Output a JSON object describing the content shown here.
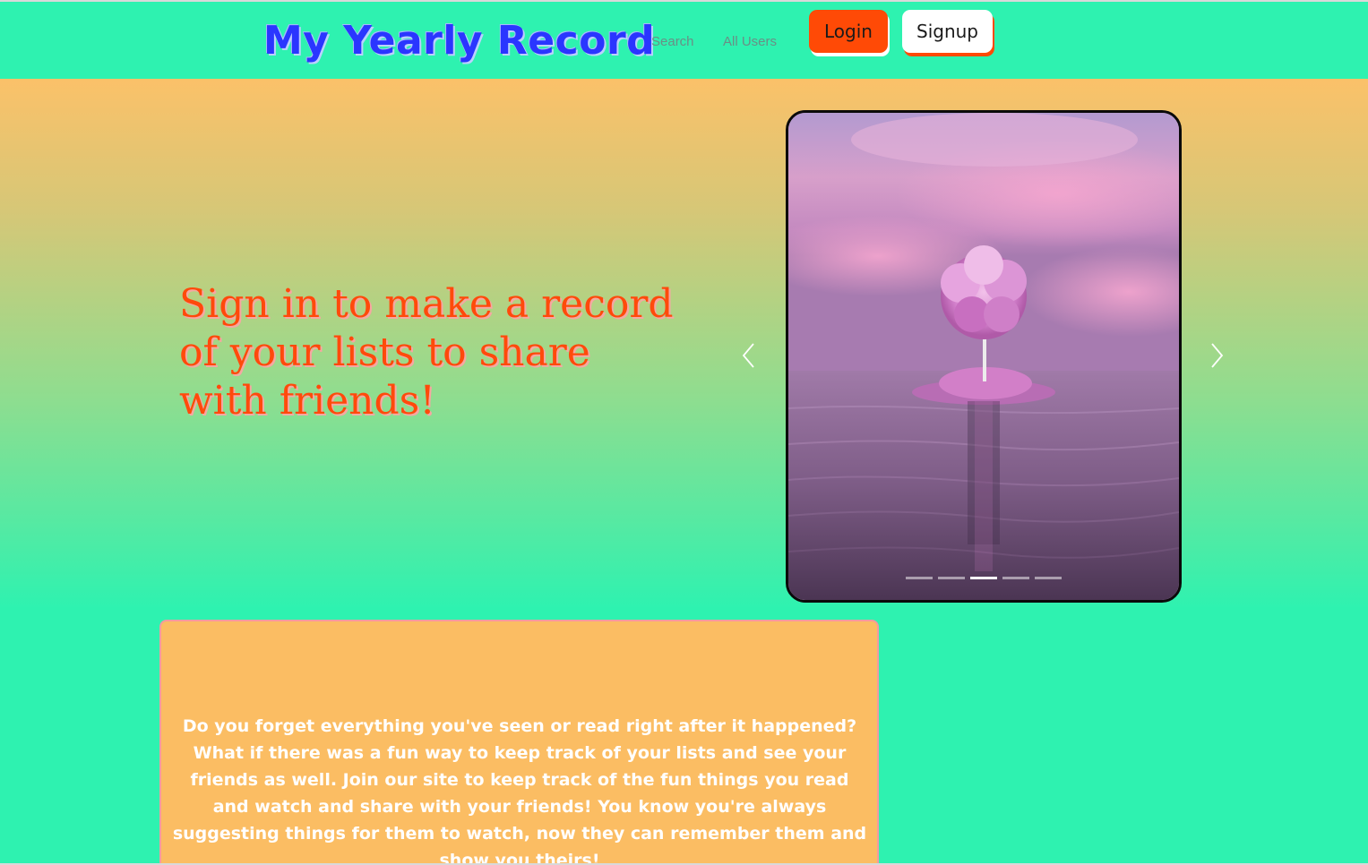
{
  "navbar": {
    "brand": "My Yearly Record",
    "links": [
      "Search",
      "All Users"
    ],
    "login_label": "Login",
    "signup_label": "Signup"
  },
  "hero": {
    "headline": "Sign in to make a record of your lists to share with friends!",
    "carousel": {
      "slide_count": 5,
      "active_slide": 3,
      "prev_icon": "chevron-left-icon",
      "next_icon": "chevron-right-icon",
      "image": "pink-tree-on-island-in-water"
    }
  },
  "info": {
    "text": "Do you forget everything you've seen or read right after it happened? What if there was a fun way to keep track of your lists and see your friends as well. Join our site to keep track of the fun things you read and watch and share with your friends! You know you're always suggesting things for them to watch, now they can remember them and show you theirs!"
  },
  "colors": {
    "page_background": "#2ef2b0",
    "accent_orange": "#ff4a06",
    "brand_blue": "#2a36ff",
    "card_background": "#fbbd63"
  }
}
